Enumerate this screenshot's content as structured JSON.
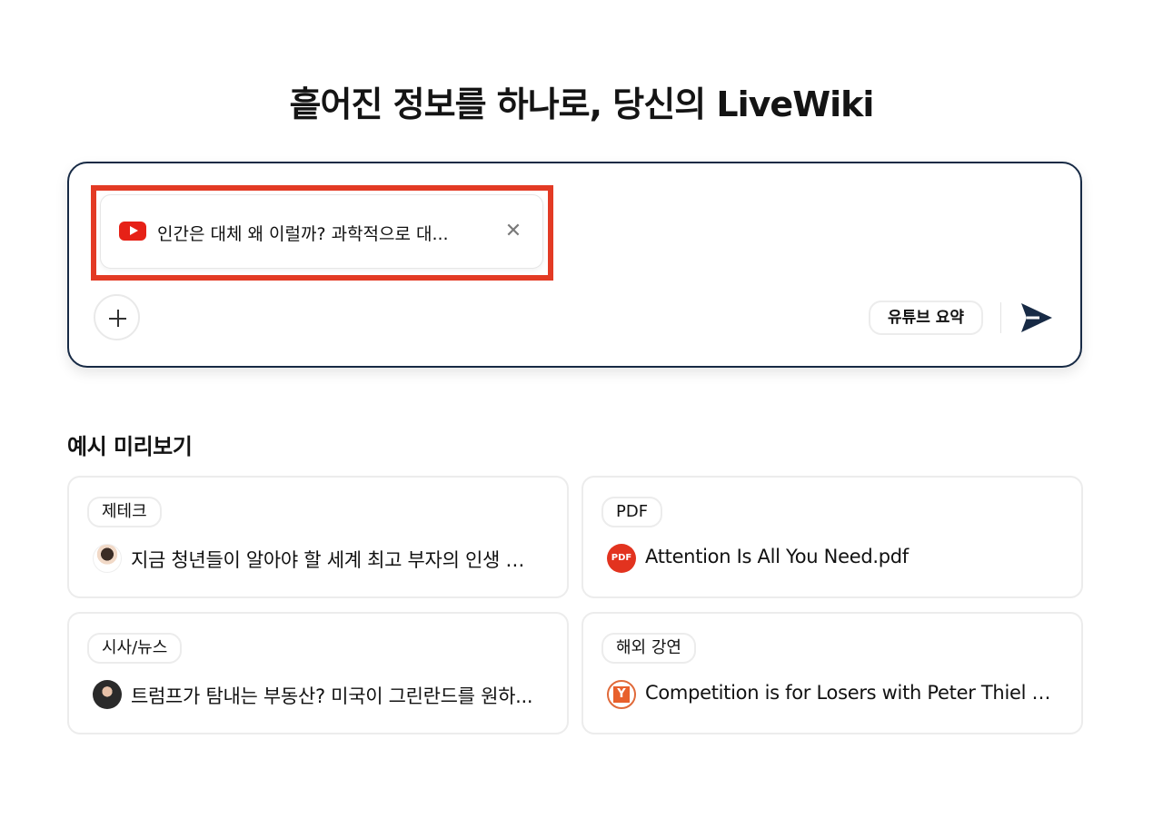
{
  "hero": {
    "title": "흩어진 정보를 하나로, 당신의 LiveWiki"
  },
  "composer": {
    "attachment": {
      "icon": "youtube-icon",
      "title": "인간은 대체 왜 이럴까? 과학적으로 대..."
    },
    "mode_label": "유튜브 요약"
  },
  "examples": {
    "section_title": "예시 미리보기",
    "cards": [
      {
        "tag": "제테크",
        "title": "지금 청년들이 알아야 할 세계 최고 부자의 인생 조언"
      },
      {
        "tag": "PDF",
        "title": "Attention Is All You Need.pdf",
        "icon_text": "PDF"
      },
      {
        "tag": "시사/뉴스",
        "title": "트럼프가 탐내는 부동산? 미국이 그린란드를 원하..."
      },
      {
        "tag": "해외 강연",
        "title": "Competition is for Losers with Peter Thiel (H...",
        "icon_text": "Y"
      }
    ]
  },
  "colors": {
    "accent": "#172a45",
    "highlight": "#e33a24",
    "youtube": "#e62117",
    "pdf": "#e2331f"
  }
}
